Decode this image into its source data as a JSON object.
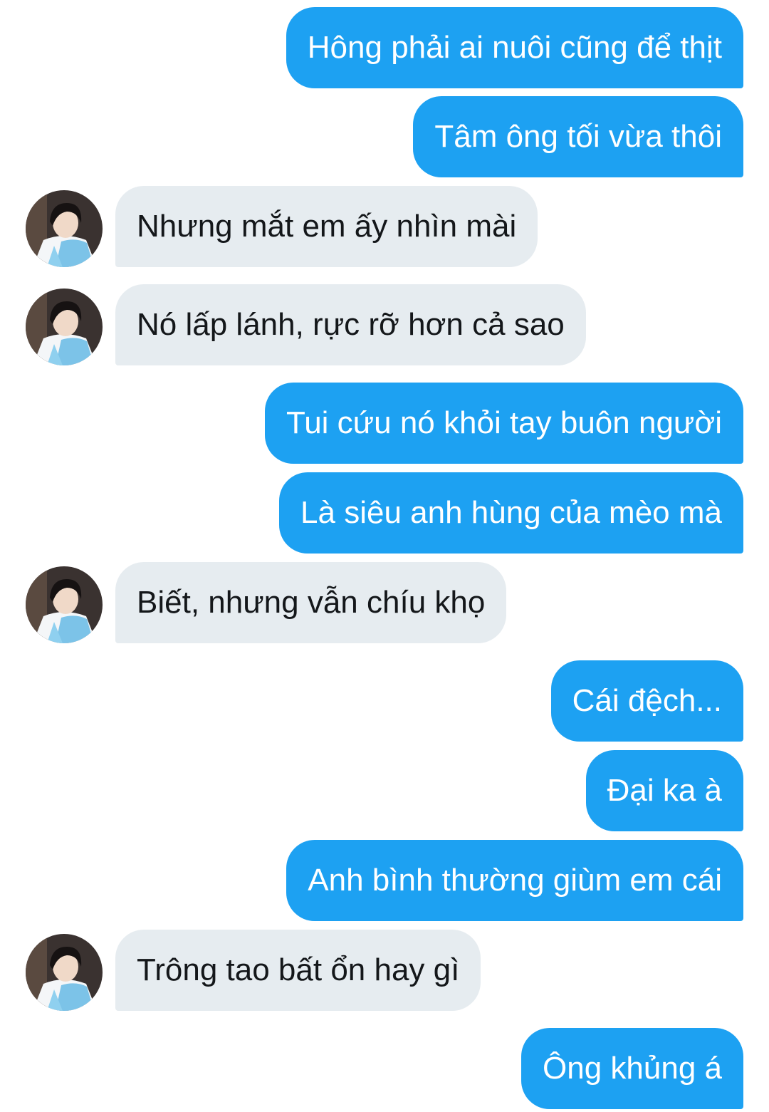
{
  "conversation": {
    "messages": [
      {
        "side": "out",
        "text": "Hông phải ai nuôi cũng để thịt"
      },
      {
        "side": "out",
        "text": "Tâm ông tối vừa thôi"
      },
      {
        "side": "in",
        "text": "Nhưng mắt em ấy nhìn mài",
        "avatar": "user-avatar"
      },
      {
        "side": "in",
        "text": "Nó lấp lánh, rực rỡ hơn cả sao",
        "avatar": "user-avatar"
      },
      {
        "side": "out",
        "text": "Tui cứu nó khỏi tay buôn người"
      },
      {
        "side": "out",
        "text": "Là siêu anh hùng của mèo mà"
      },
      {
        "side": "in",
        "text": "Biết, nhưng vẫn chíu khọ",
        "avatar": "user-avatar"
      },
      {
        "side": "out",
        "text": "Cái đệch..."
      },
      {
        "side": "out",
        "text": "Đại ka à"
      },
      {
        "side": "out",
        "text": "Anh bình thường giùm em cái"
      },
      {
        "side": "in",
        "text": "Trông tao bất ổn hay gì",
        "avatar": "user-avatar"
      },
      {
        "side": "out",
        "text": "Ông khủng á"
      }
    ]
  },
  "colors": {
    "outgoing_bubble": "#1da1f2",
    "incoming_bubble": "#e6ecf0",
    "outgoing_text": "#ffffff",
    "incoming_text": "#14171a"
  }
}
